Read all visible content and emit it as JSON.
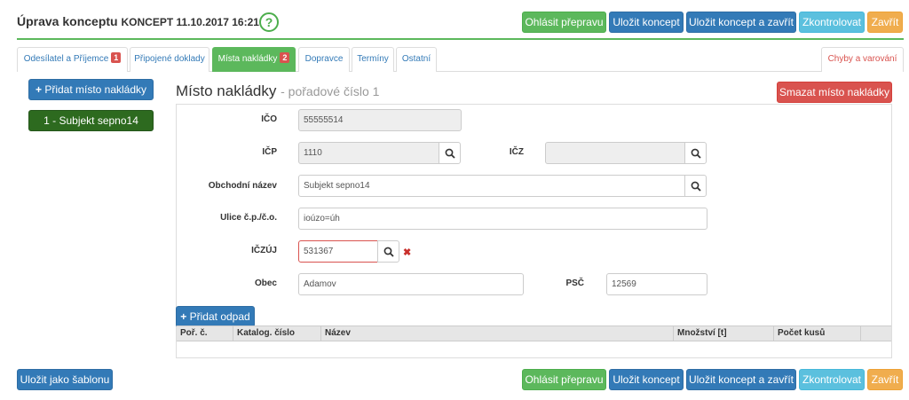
{
  "header": {
    "title": "Úprava konceptu",
    "subtitle": "KONCEPT 11.10.2017 16:21",
    "help_glyph": "?"
  },
  "top_actions": {
    "report": "Ohlásit přepravu",
    "save": "Uložit koncept",
    "save_close": "Uložit koncept a zavřít",
    "check": "Zkontrolovat",
    "close": "Zavřít"
  },
  "tabs": [
    {
      "label": "Odesílatel a Příjemce",
      "badge": "1"
    },
    {
      "label": "Připojené doklady",
      "badge": ""
    },
    {
      "label": "Místa nakládky",
      "badge": "2"
    },
    {
      "label": "Dopravce",
      "badge": ""
    },
    {
      "label": "Termíny",
      "badge": ""
    },
    {
      "label": "Ostatní",
      "badge": ""
    }
  ],
  "errors_tab": "Chyby a varování",
  "sidebar": {
    "add_label": "Přidat místo nakládky",
    "items": [
      "1 - Subjekt sepno14"
    ]
  },
  "section": {
    "title": "Místo nakládky",
    "subtitle": "- pořadové číslo 1",
    "delete_label": "Smazat místo nakládky"
  },
  "form": {
    "ico": {
      "label": "IČO",
      "value": "55555514"
    },
    "icp": {
      "label": "IČP",
      "value": "1110"
    },
    "icz": {
      "label": "IČZ",
      "value": ""
    },
    "name": {
      "label": "Obchodní název",
      "value": "Subjekt sepno14"
    },
    "street": {
      "label": "Ulice č.p./č.o.",
      "value": "ioúzo=úh"
    },
    "iczuj": {
      "label": "IČZÚJ",
      "value": "531367"
    },
    "obec": {
      "label": "Obec",
      "value": "Adamov"
    },
    "psc": {
      "label": "PSČ",
      "value": "12569"
    }
  },
  "waste": {
    "add_label": "Přidat odpad",
    "columns": [
      "Poř. č.",
      "Katalog. číslo",
      "Název",
      "Množství [t]",
      "Počet kusů"
    ]
  },
  "footer": {
    "template_label": "Uložit jako šablonu"
  },
  "colors": {
    "green": "#5cb85c",
    "blue": "#337ab7",
    "cyan": "#5bc0de",
    "orange": "#f0ad4e",
    "red": "#d9534f",
    "dark_green": "#2d6a1f"
  }
}
